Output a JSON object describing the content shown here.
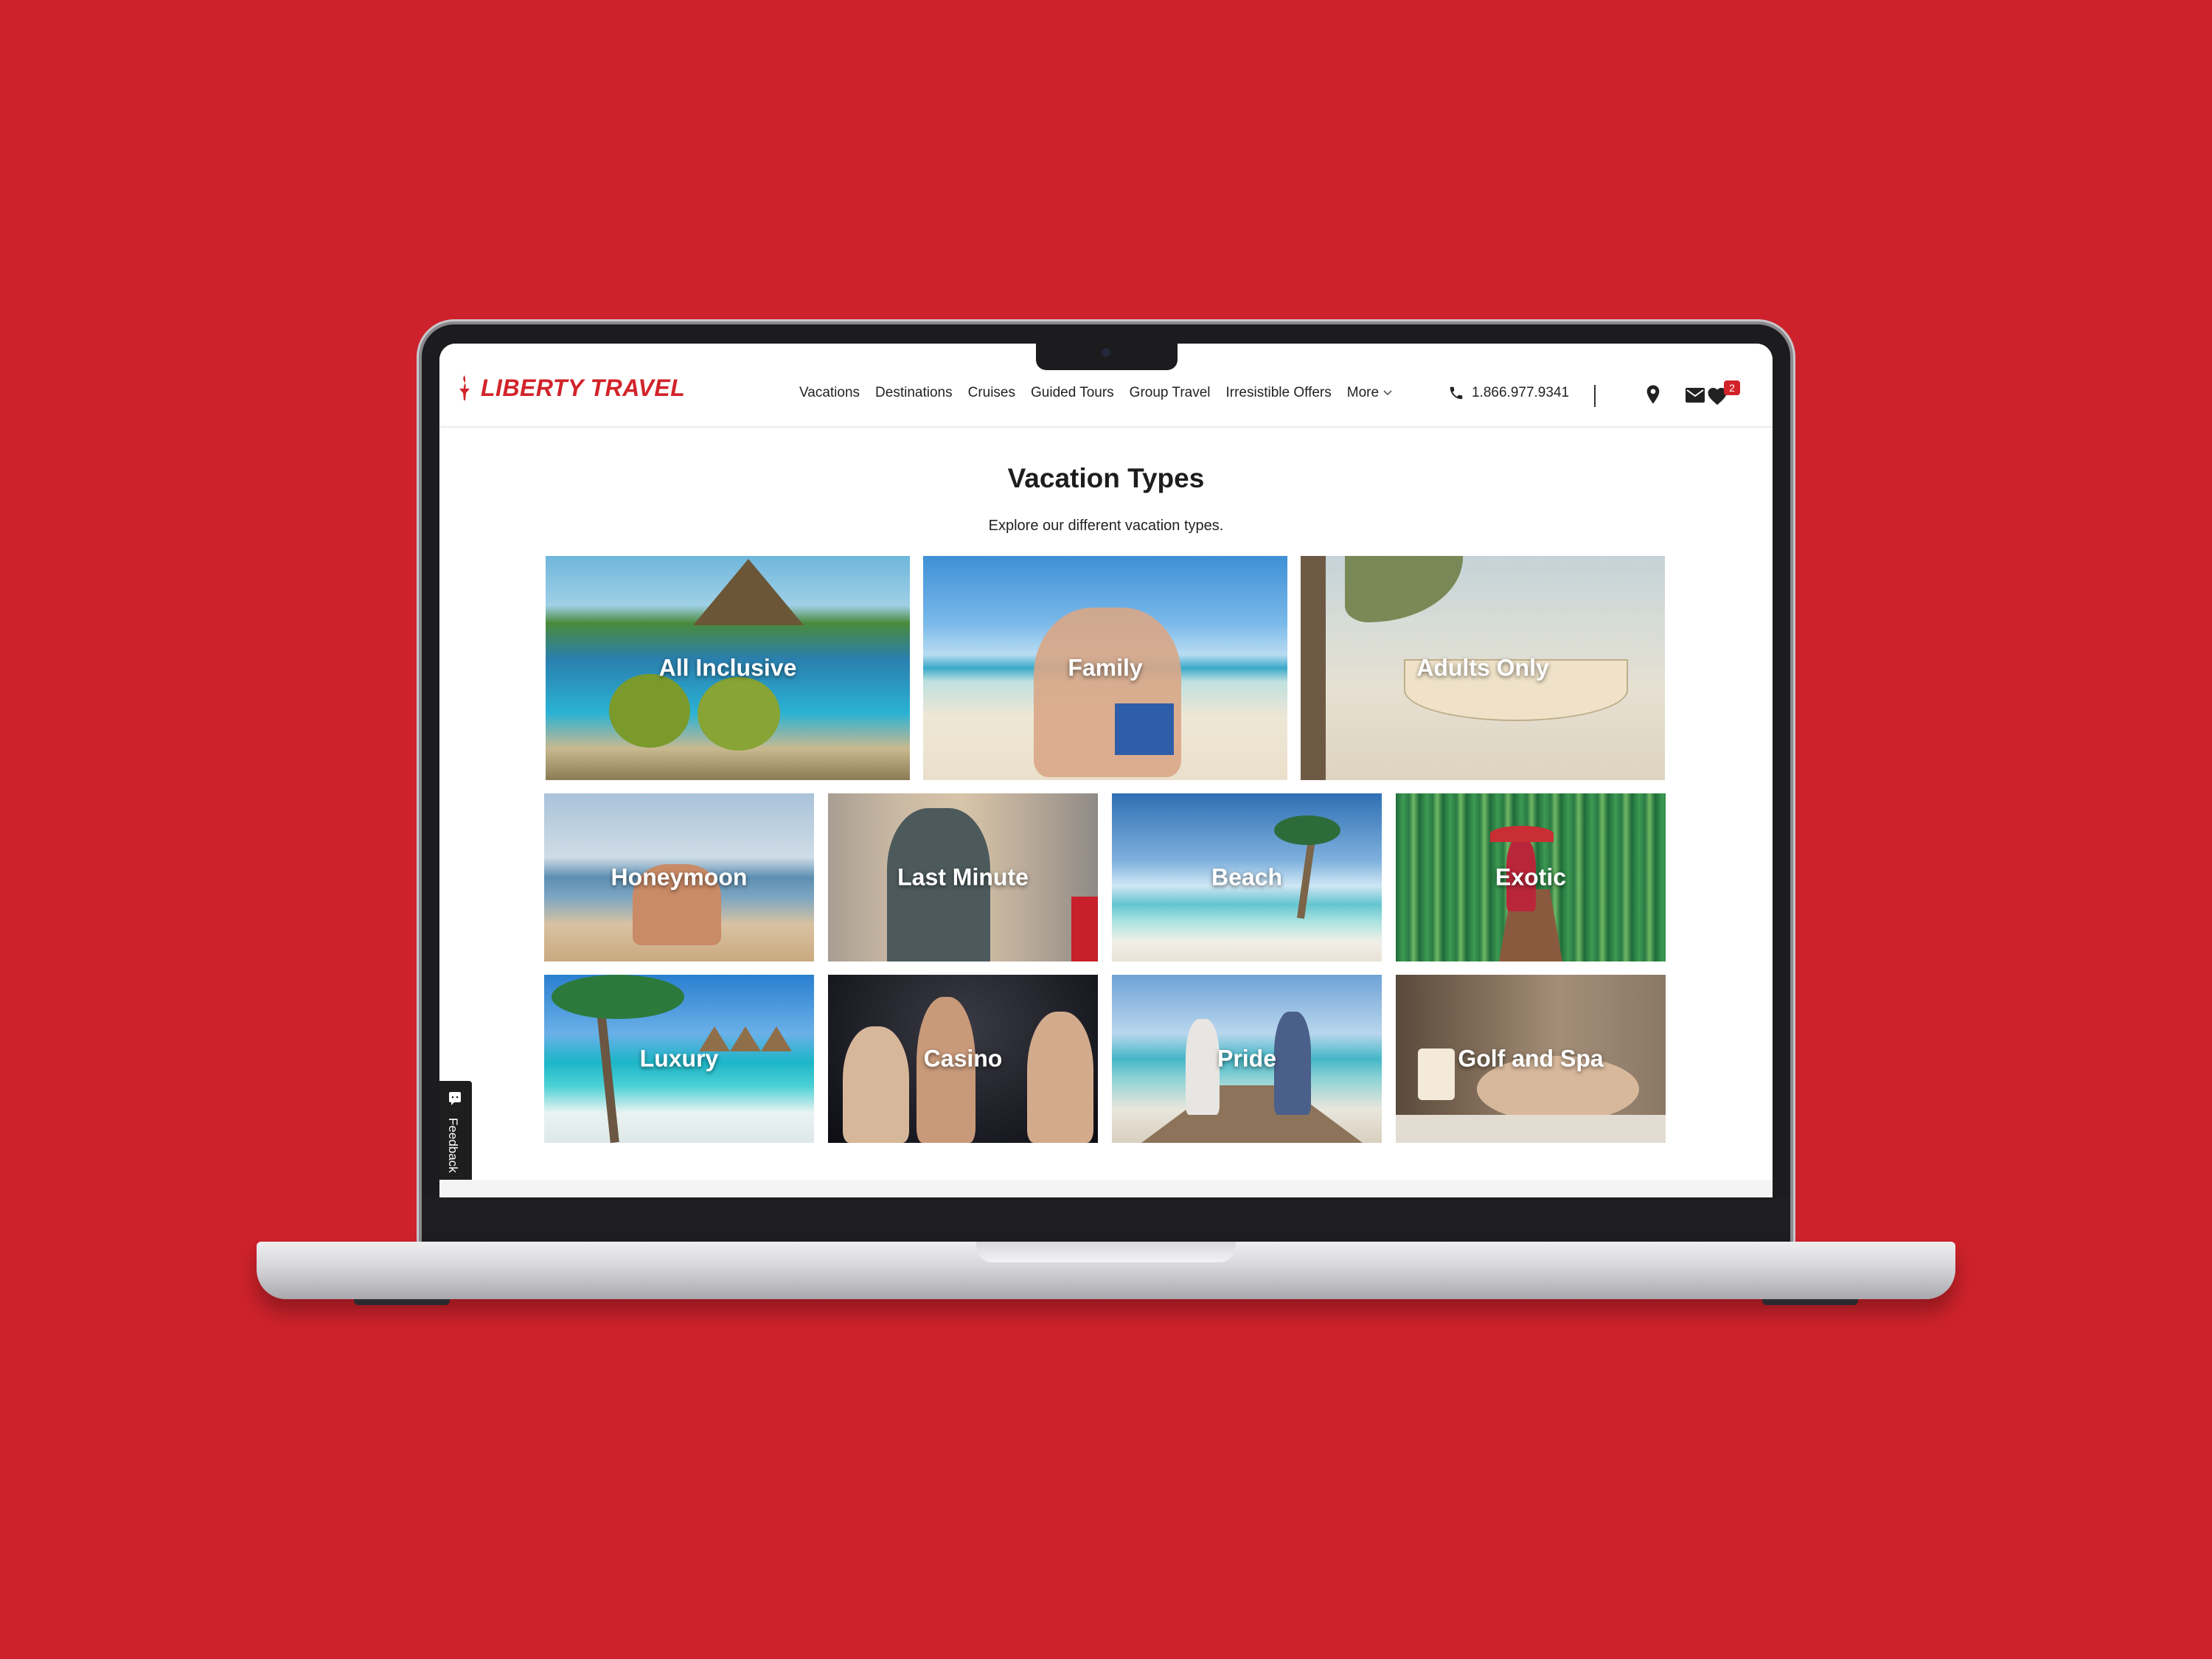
{
  "brand": {
    "name": "LIBERTY TRAVEL",
    "color": "#d2232a"
  },
  "nav": {
    "items": [
      "Vacations",
      "Destinations",
      "Cruises",
      "Guided Tours",
      "Group Travel",
      "Irresistible Offers"
    ],
    "more_label": "More",
    "phone": "1.866.977.9341",
    "wishlist_count": "2",
    "icons": [
      "phone-icon",
      "location-pin-icon",
      "mail-icon",
      "heart-icon"
    ]
  },
  "page": {
    "title": "Vacation Types",
    "subtitle": "Explore our different vacation types."
  },
  "tiles": [
    {
      "label": "All Inclusive"
    },
    {
      "label": "Family"
    },
    {
      "label": "Adults Only"
    },
    {
      "label": "Honeymoon"
    },
    {
      "label": "Last Minute"
    },
    {
      "label": "Beach"
    },
    {
      "label": "Exotic"
    },
    {
      "label": "Luxury"
    },
    {
      "label": "Casino"
    },
    {
      "label": "Pride"
    },
    {
      "label": "Golf and Spa"
    }
  ],
  "feedback": {
    "label": "Feedback"
  }
}
